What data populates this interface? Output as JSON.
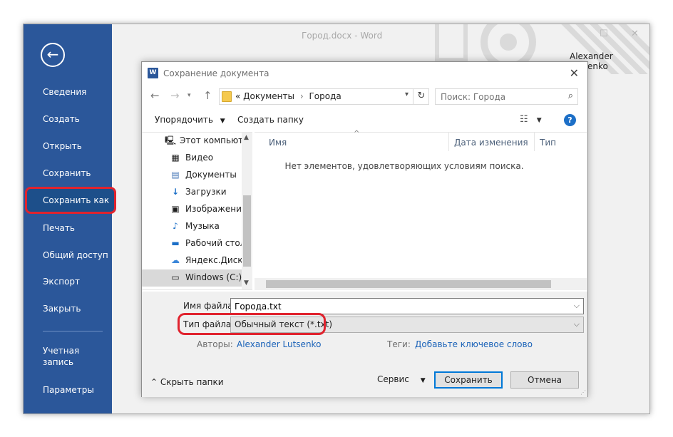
{
  "word": {
    "title": "Город.docx - Word",
    "user": "Alexander Lutsenko",
    "back_icon": "arrow-left-icon",
    "menu": [
      {
        "label": "Сведения"
      },
      {
        "label": "Создать"
      },
      {
        "label": "Открыть"
      },
      {
        "label": "Сохранить"
      },
      {
        "label": "Сохранить как",
        "active": true
      },
      {
        "label": "Печать"
      },
      {
        "label": "Общий доступ"
      },
      {
        "label": "Экспорт"
      },
      {
        "label": "Закрыть"
      },
      {
        "label": "Учетная запись"
      },
      {
        "label": "Параметры"
      }
    ],
    "colors": {
      "sidebar": "#2b579a",
      "highlight": "#e0232e"
    }
  },
  "dialog": {
    "title": "Сохранение документа",
    "address": {
      "prefix": "«",
      "path": [
        "Документы",
        "Города"
      ]
    },
    "search_placeholder": "Поиск: Города",
    "toolbar": {
      "organize": "Упорядочить",
      "new_folder": "Создать папку"
    },
    "tree": [
      {
        "label": "Этот компьютер",
        "icon": "computer-icon"
      },
      {
        "label": "Видео",
        "icon": "video-icon"
      },
      {
        "label": "Документы",
        "icon": "documents-icon"
      },
      {
        "label": "Загрузки",
        "icon": "downloads-icon"
      },
      {
        "label": "Изображения",
        "icon": "pictures-icon"
      },
      {
        "label": "Музыка",
        "icon": "music-icon"
      },
      {
        "label": "Рабочий стол",
        "icon": "desktop-icon"
      },
      {
        "label": "Яндекс.Диск",
        "icon": "yandex-disk-icon"
      },
      {
        "label": "Windows (C:)",
        "icon": "drive-icon",
        "selected": true
      }
    ],
    "columns": [
      "Имя",
      "Дата изменения",
      "Тип"
    ],
    "empty_message": "Нет элементов, удовлетворяющих условиям поиска.",
    "form": {
      "filename_label": "Имя файла:",
      "filename_value": "Города.txt",
      "filetype_label": "Тип файла:",
      "filetype_value": "Обычный текст (*.txt)",
      "authors_label": "Авторы:",
      "authors_value": "Alexander Lutsenko",
      "tags_label": "Теги:",
      "tags_value": "Добавьте ключевое слово"
    },
    "footer": {
      "hide_folders": "Скрыть папки",
      "service": "Сервис",
      "save": "Сохранить",
      "cancel": "Отмена"
    }
  }
}
